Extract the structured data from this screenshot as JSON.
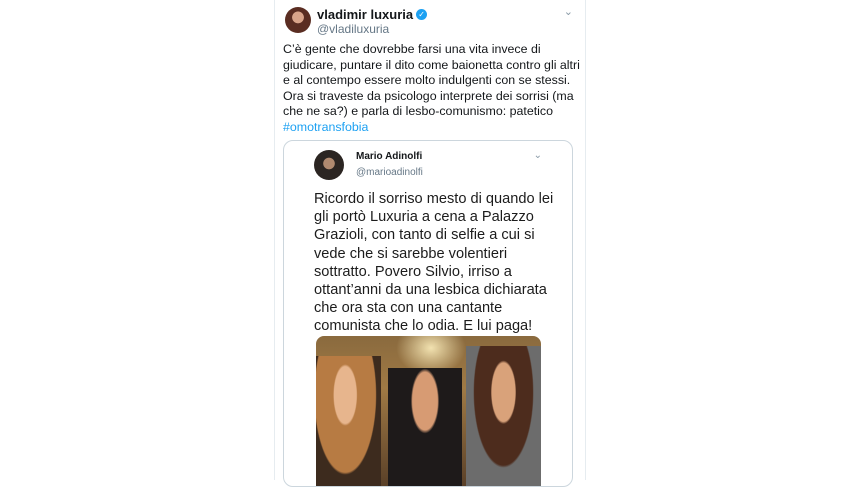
{
  "tweet": {
    "display_name": "vladimir luxuria",
    "handle": "@vladiluxuria",
    "text": "C’è gente che dovrebbe farsi una vita invece di giudicare, puntare il dito come baionetta contro gli altri e al contempo essere molto indulgenti con se stessi. Ora si traveste da psicologo interprete dei sorrisi (ma che ne sa?) e parla di lesbo-comunismo: patetico ",
    "hashtag": "#omotransfobia"
  },
  "quote": {
    "display_name": "Mario Adinolfi",
    "handle": "@marioadinolfi",
    "text": "Ricordo il sorriso mesto di quando lei gli portò Luxuria a cena a Palazzo Grazioli, con tanto di selfie a cui si vede che si sarebbe volentieri sottratto. Povero Silvio, irriso a ottant’anni da una lesbica dichiarata che ora sta con una cantante comunista che lo odia. E lui paga!"
  },
  "icons": {
    "verified": "verified-badge-icon",
    "menu": "chevron-down-icon"
  },
  "colors": {
    "link": "#1da1f2",
    "secondary_text": "#657786",
    "border": "#ccd6dd"
  }
}
